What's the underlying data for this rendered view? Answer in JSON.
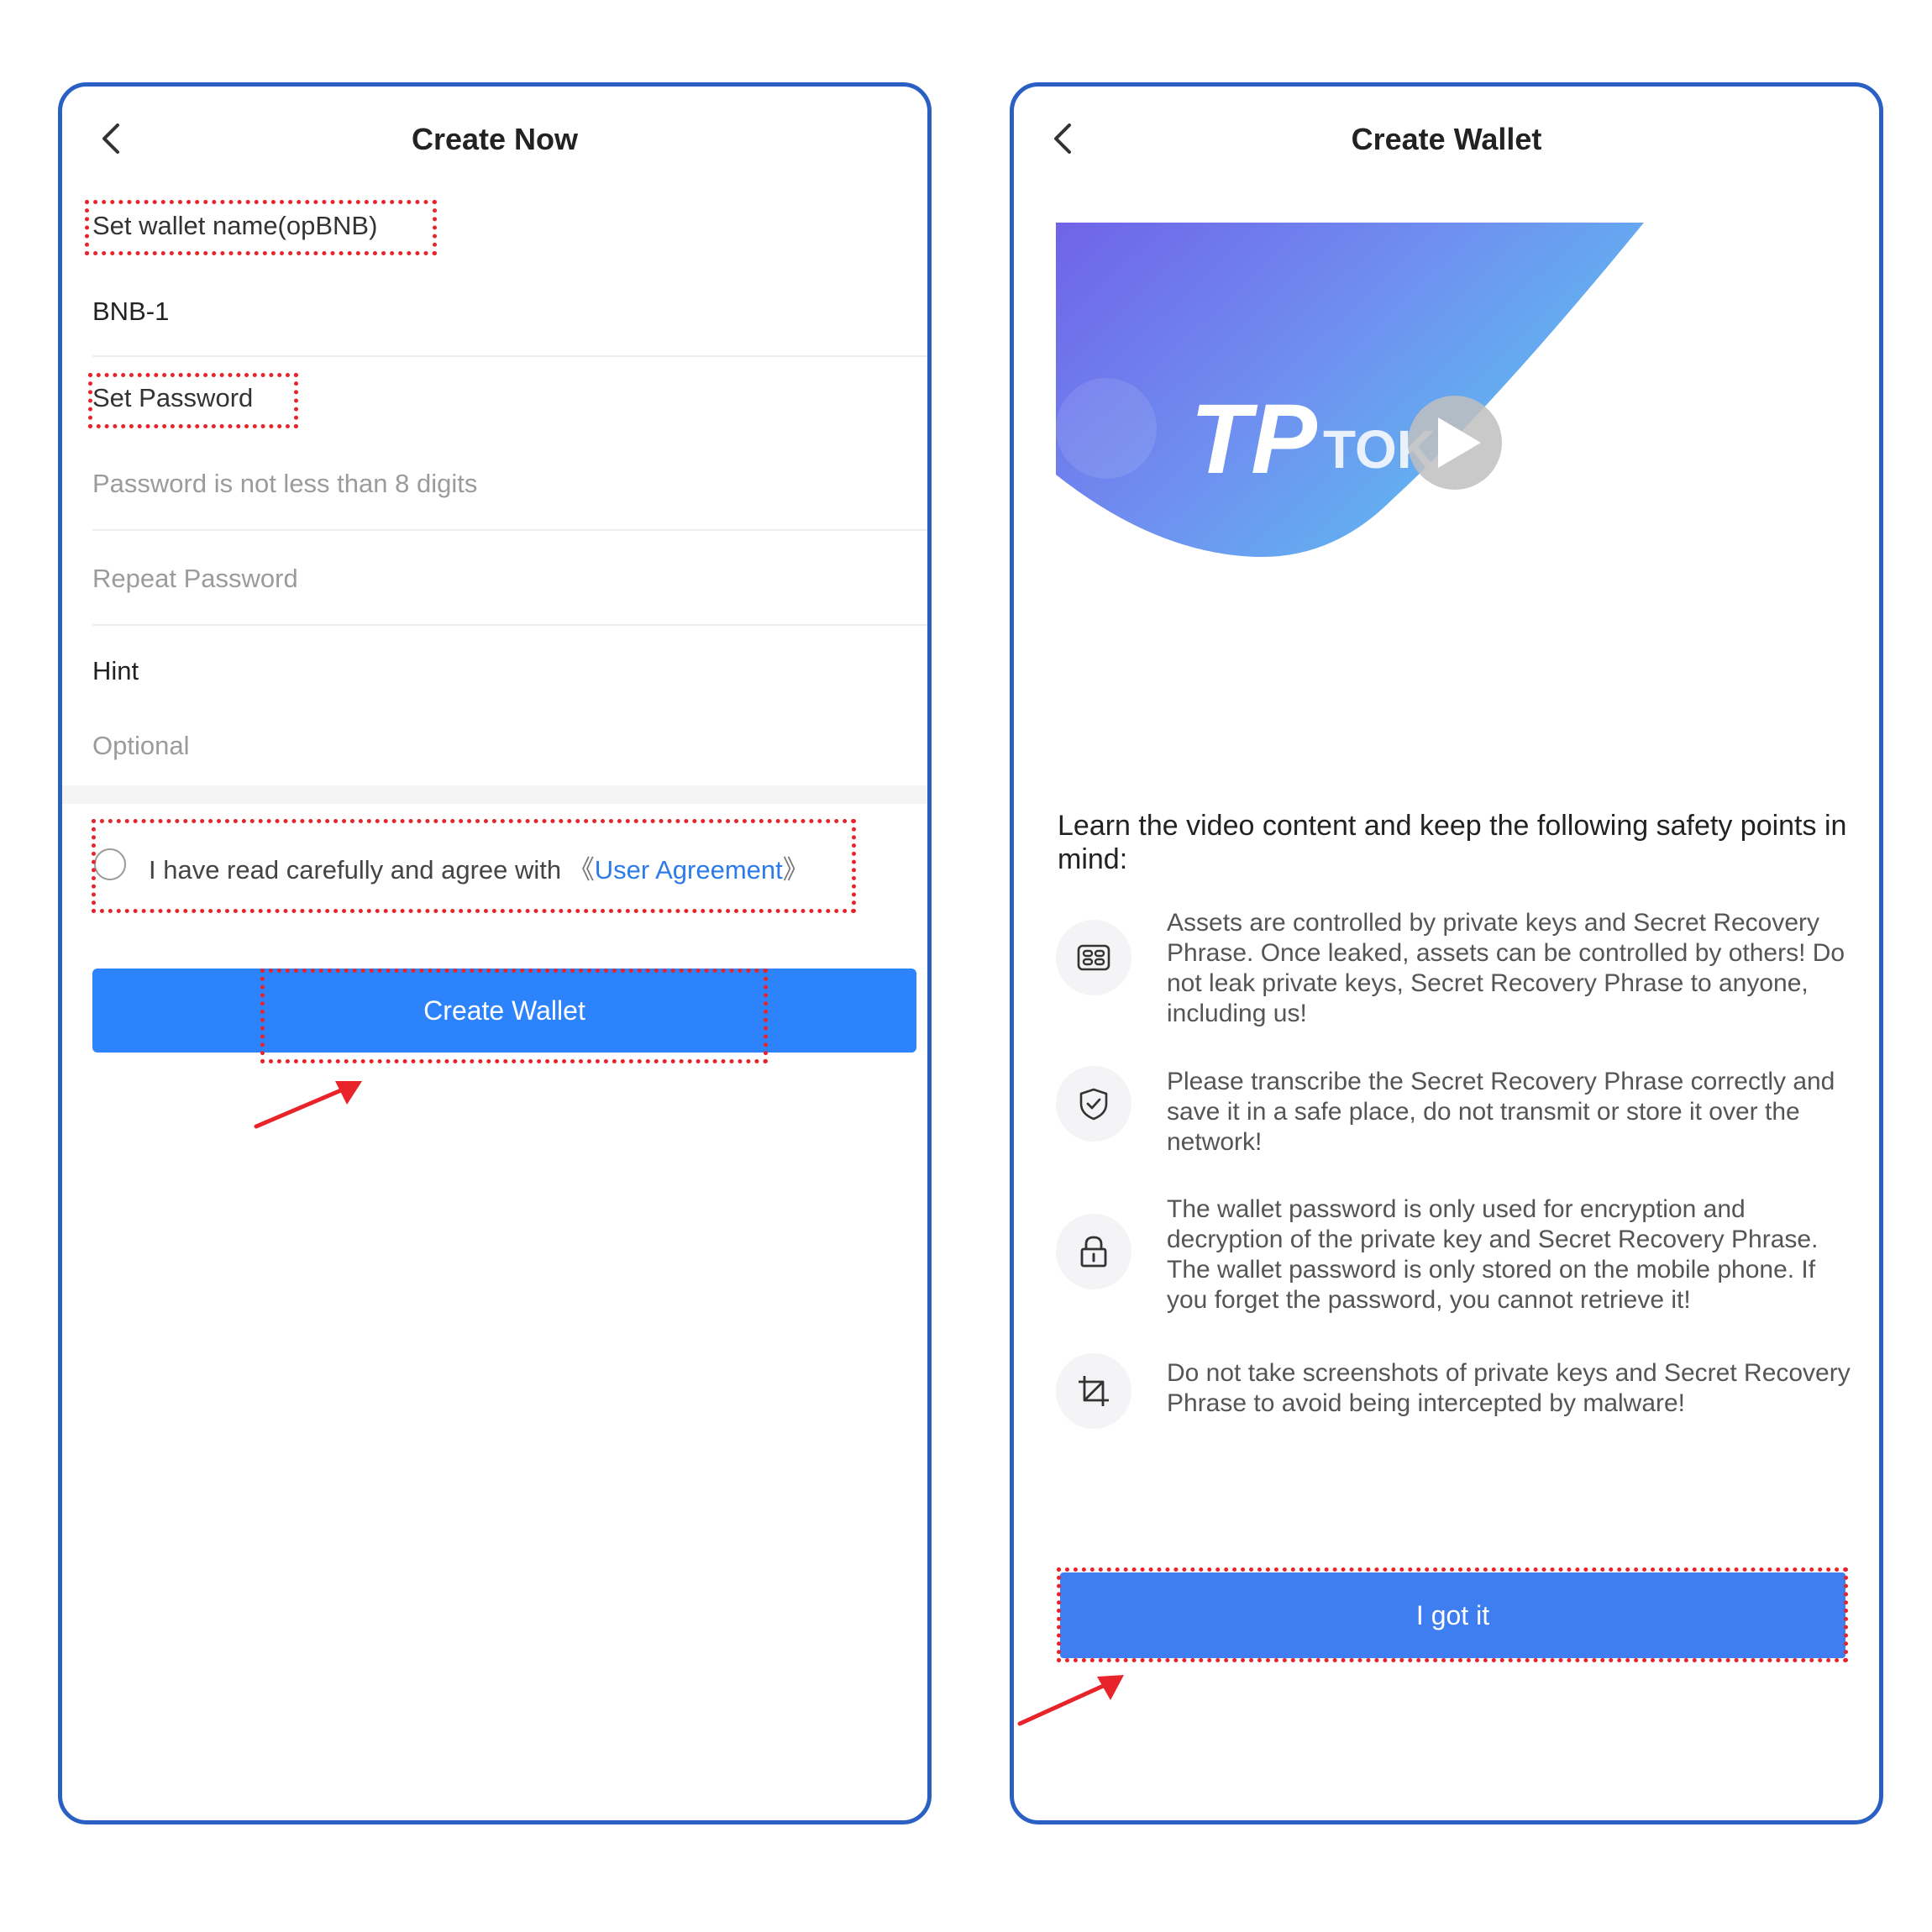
{
  "left_screen": {
    "title": "Create Now",
    "wallet_name_label": "Set wallet name(opBNB)",
    "wallet_name_value": "BNB-1",
    "password_label": "Set Password",
    "password_placeholder": "Password is not less than 8 digits",
    "repeat_password_placeholder": "Repeat Password",
    "hint_label": "Hint",
    "hint_placeholder": "Optional",
    "agreement_text": "I have read carefully and agree with",
    "agreement_open": "《",
    "agreement_link": "User Agreement",
    "agreement_close": "》",
    "create_button": "Create Wallet"
  },
  "right_screen": {
    "title": "Create Wallet",
    "video_brand_logo": "TP",
    "video_brand_text": "TOKENPOCKET",
    "intro": "Learn the video content and keep the following safety points in mind:",
    "tips": [
      {
        "icon": "keys-icon",
        "text": "Assets are controlled by private keys and Secret Recovery Phrase. Once leaked, assets can be controlled by others! Do not leak private keys, Secret Recovery Phrase to anyone, including us!"
      },
      {
        "icon": "shield-check-icon",
        "text": "Please transcribe the Secret Recovery Phrase correctly and save it in a safe place, do not transmit or store it over the network!"
      },
      {
        "icon": "lock-icon",
        "text": "The wallet password is only used for encryption and decryption of the private key and Secret Recovery Phrase. The wallet password is only stored on the mobile phone. If you forget the password, you cannot retrieve it!"
      },
      {
        "icon": "crop-icon",
        "text": "Do not take screenshots of private keys and Secret Recovery Phrase to avoid being intercepted by malware!"
      }
    ],
    "confirm_button": "I got it"
  },
  "colors": {
    "frame": "#2a5fc4",
    "primary_button": "#2d83fc",
    "confirm_button": "#3f7ef0",
    "link": "#2d7be8",
    "highlight": "#e8232a"
  }
}
